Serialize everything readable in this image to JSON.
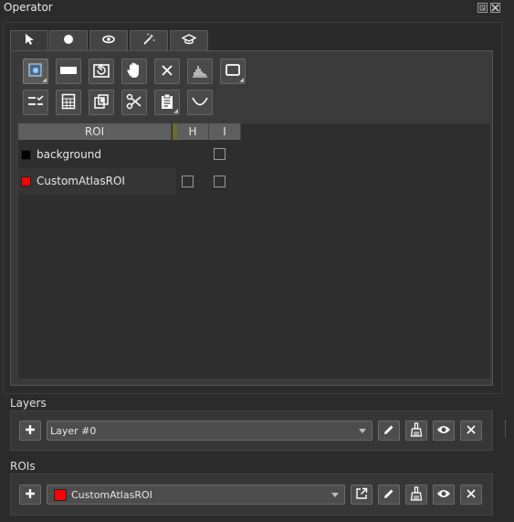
{
  "window": {
    "title": "Operator"
  },
  "tabs": [
    {
      "name": "cursor",
      "icon": "cursor-icon"
    },
    {
      "name": "circle",
      "icon": "circle-icon"
    },
    {
      "name": "brush",
      "icon": "brush-icon"
    },
    {
      "name": "magic",
      "icon": "magic-wand-icon"
    },
    {
      "name": "learn",
      "icon": "graduation-cap-icon"
    }
  ],
  "toolbar": {
    "row1": [
      "roi-select-icon",
      "rectangle-icon",
      "reset-icon",
      "hand-icon",
      "close-icon",
      "histogram-icon",
      "square-icon"
    ],
    "row2": [
      "checklist-icon",
      "calculator-icon",
      "copy-icon",
      "scissors-icon",
      "clipboard-icon",
      "bowl-icon"
    ]
  },
  "roi_table": {
    "headers": {
      "roi": "ROI",
      "h": "H",
      "i": "I"
    },
    "rows": [
      {
        "label": "background",
        "color": "#000000",
        "h_shown": false,
        "h_checked": false,
        "i_checked": false
      },
      {
        "label": "CustomAtlasROI",
        "color": "#ff0000",
        "h_shown": true,
        "h_checked": false,
        "i_checked": false
      }
    ]
  },
  "layers": {
    "label": "Layers",
    "selected": "Layer #0"
  },
  "rois": {
    "label": "ROIs",
    "selected": "CustomAtlasROI",
    "selected_color": "#ff0000"
  }
}
